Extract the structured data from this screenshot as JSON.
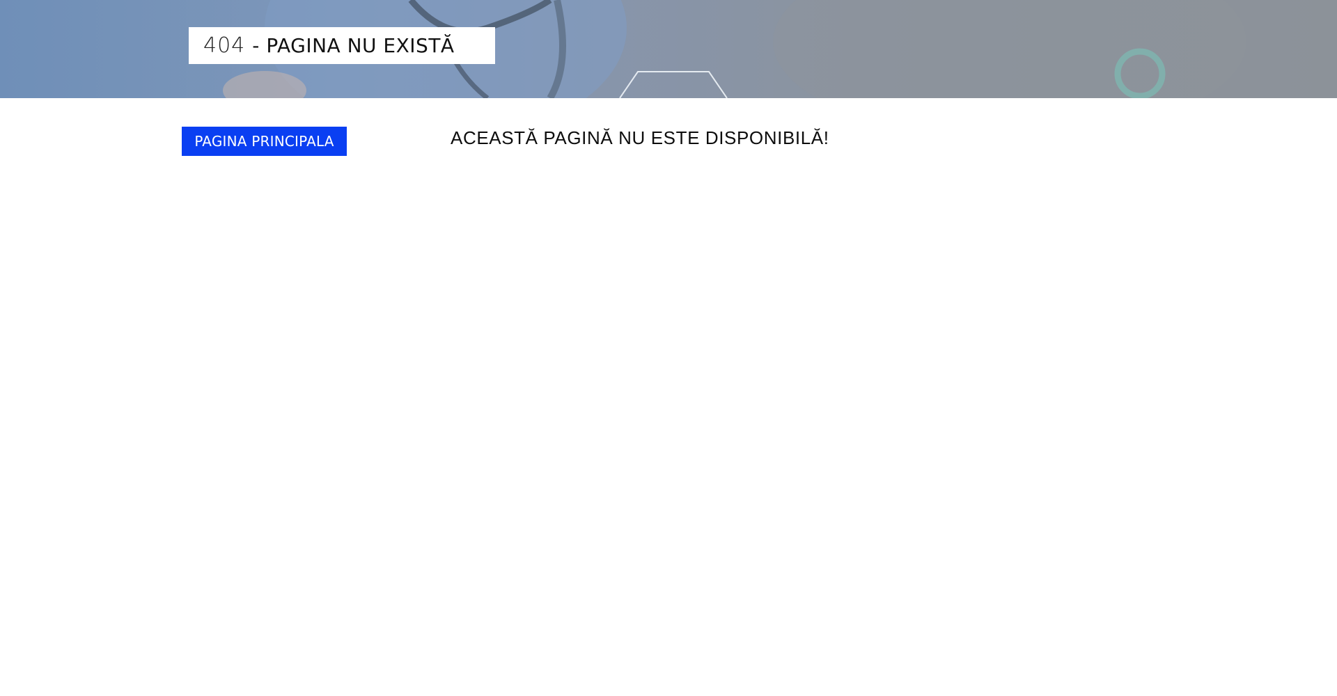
{
  "hero": {
    "image": "doctor-with-stethoscope-photo",
    "title_code": "404",
    "title_separator": "-",
    "title_text": "PAGINA NU EXISTĂ"
  },
  "nav": {
    "home_button_label": "PAGINA PRINCIPALA"
  },
  "main": {
    "message": "ACEASTĂ PAGINĂ NU ESTE DISPONIBILĂ!"
  },
  "colors": {
    "accent": "#0a3ff2",
    "hero_overlay": "#8795ab",
    "text": "#0d0d0d"
  }
}
